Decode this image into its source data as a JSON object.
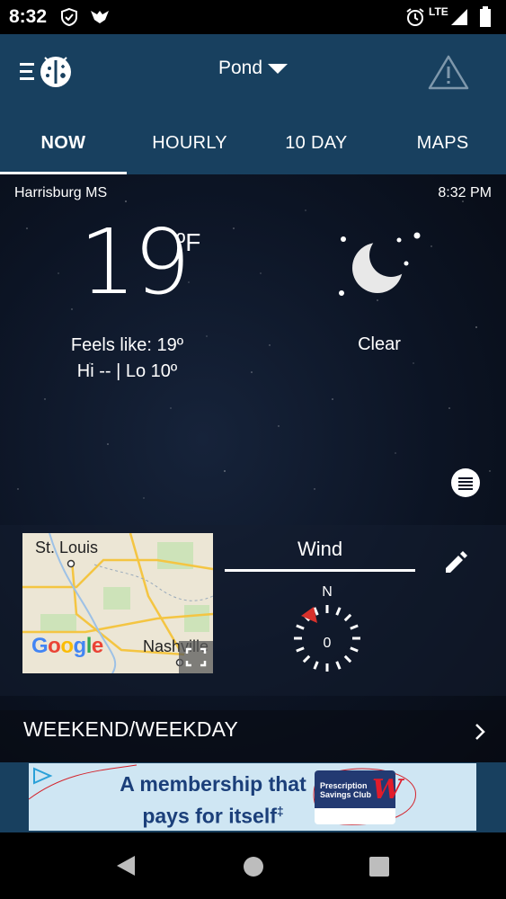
{
  "status_bar": {
    "time": "8:32",
    "network": "LTE"
  },
  "app_bar": {
    "location": "Pond"
  },
  "tabs": [
    {
      "label": "NOW"
    },
    {
      "label": "HOURLY"
    },
    {
      "label": "10 DAY"
    },
    {
      "label": "MAPS"
    }
  ],
  "current": {
    "city": "Harrisburg MS",
    "time": "8:32 PM",
    "temperature": "19",
    "unit": "ºF",
    "feels_like": "Feels like: 19º",
    "hi_lo": "Hi -- | Lo 10º",
    "condition": "Clear"
  },
  "map": {
    "labels": {
      "city1": "St. Louis",
      "city2": "Nashville"
    },
    "brand": "Google"
  },
  "wind": {
    "title": "Wind",
    "north": "N",
    "speed": "0"
  },
  "weekend_row": {
    "label": "WEEKEND/WEEKDAY"
  },
  "ad": {
    "line1": "A membership that",
    "line2": "pays for itself",
    "dagger": "‡",
    "card_title": "Prescription Savings Club",
    "card_logo": "W"
  },
  "colors": {
    "header": "#18405f",
    "background": "#0c1424",
    "ad_background": "#cfe6f3",
    "ad_text": "#1b3f7a",
    "ad_brand": "#e21c2a"
  },
  "icons": [
    "shield-icon",
    "bird-icon",
    "alarm-icon",
    "signal-icon",
    "battery-icon",
    "menu-icon",
    "app-logo-icon",
    "dropdown-caret-icon",
    "alert-triangle-icon",
    "moon-icon",
    "list-icon",
    "expand-icon",
    "pencil-icon",
    "compass-icon",
    "chevron-right-icon",
    "back-icon",
    "home-icon",
    "recents-icon"
  ]
}
